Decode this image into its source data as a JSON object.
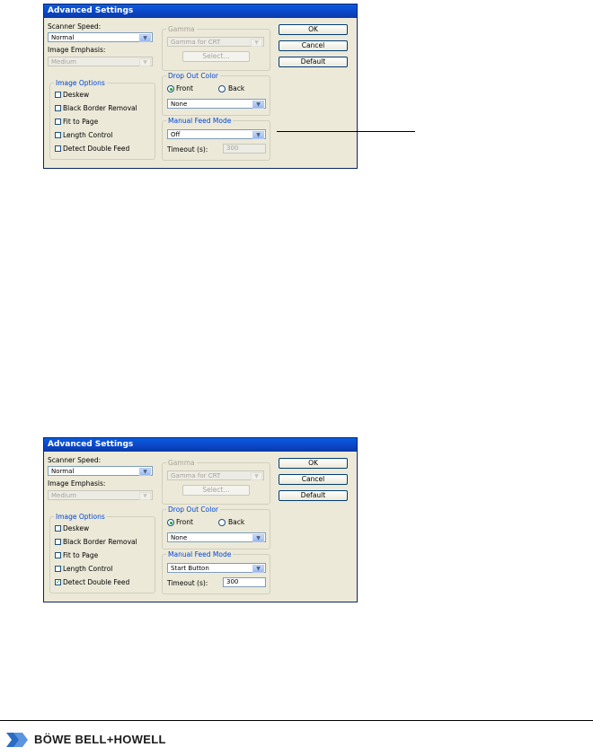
{
  "dialogs": [
    {
      "title": "Advanced Settings",
      "scanner_speed": {
        "label": "Scanner Speed:",
        "value": "Normal"
      },
      "image_emphasis": {
        "label": "Image Emphasis:",
        "value": "Medium"
      },
      "image_options": {
        "title": "Image Options",
        "items": [
          {
            "label": "Deskew",
            "checked": false
          },
          {
            "label": "Black Border Removal",
            "checked": false
          },
          {
            "label": "Fit to Page",
            "checked": false
          },
          {
            "label": "Length Control",
            "checked": false
          },
          {
            "label": "Detect Double Feed",
            "checked": false
          }
        ]
      },
      "gamma": {
        "title": "Gamma",
        "value": "Gamma for CRT",
        "select_label": "Select..."
      },
      "drop_out_color": {
        "title": "Drop Out Color",
        "front_label": "Front",
        "back_label": "Back",
        "selected": "Front",
        "value": "None"
      },
      "manual_feed_mode": {
        "title": "Manual Feed Mode",
        "value": "Off",
        "timeout_label": "Timeout (s):",
        "timeout_value": "300",
        "timeout_enabled": false
      },
      "buttons": {
        "ok": "OK",
        "cancel": "Cancel",
        "default": "Default"
      }
    },
    {
      "title": "Advanced Settings",
      "scanner_speed": {
        "label": "Scanner Speed:",
        "value": "Normal"
      },
      "image_emphasis": {
        "label": "Image Emphasis:",
        "value": "Medium"
      },
      "image_options": {
        "title": "Image Options",
        "items": [
          {
            "label": "Deskew",
            "checked": false
          },
          {
            "label": "Black Border Removal",
            "checked": false
          },
          {
            "label": "Fit to Page",
            "checked": false
          },
          {
            "label": "Length Control",
            "checked": false
          },
          {
            "label": "Detect Double Feed",
            "checked": true
          }
        ]
      },
      "gamma": {
        "title": "Gamma",
        "value": "Gamma for CRT",
        "select_label": "Select..."
      },
      "drop_out_color": {
        "title": "Drop Out Color",
        "front_label": "Front",
        "back_label": "Back",
        "selected": "Front",
        "value": "None"
      },
      "manual_feed_mode": {
        "title": "Manual Feed Mode",
        "value": "Start Button",
        "timeout_label": "Timeout (s):",
        "timeout_value": "300",
        "timeout_enabled": true
      },
      "buttons": {
        "ok": "OK",
        "cancel": "Cancel",
        "default": "Default"
      }
    }
  ],
  "footer": {
    "brand": "BÖWE BELL+HOWELL",
    "icon": "bbh-logo-icon"
  },
  "colors": {
    "titlebar": "#0b47c8",
    "dialog_bg": "#ece9d8",
    "group_title": "#0046d5",
    "check": "#21a121"
  }
}
